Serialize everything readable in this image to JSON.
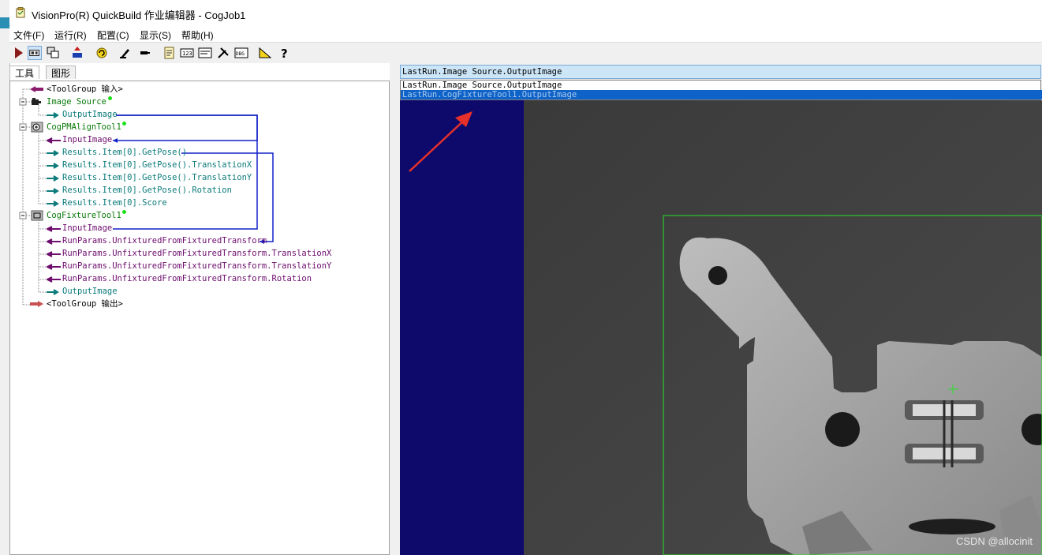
{
  "window": {
    "title": "VisionPro(R) QuickBuild 作业编辑器 - CogJob1"
  },
  "menu": [
    {
      "label": "文件(F)"
    },
    {
      "label": "运行(R)"
    },
    {
      "label": "配置(C)"
    },
    {
      "label": "显示(S)"
    },
    {
      "label": "帮助(H)"
    }
  ],
  "toolbar_icons": [
    "run-icon",
    "run-continuous-icon",
    "settings-icon",
    "reset-icon",
    "refresh-icon",
    "edit-icon",
    "tool-icon",
    "notes-icon",
    "counter-icon",
    "display-icon",
    "wrench-icon",
    "debug-icon",
    "ruler-icon",
    "help-icon"
  ],
  "tabs": {
    "tools": "工具",
    "graphics": "图形"
  },
  "tree": {
    "input": "<ToolGroup 输入>",
    "image_source": "Image Source",
    "image_source_output": "OutputImage",
    "pm_align": "CogPMAlignTool1",
    "pm_input": "InputImage",
    "pm_pose": "Results.Item[0].GetPose()",
    "pm_tx": "Results.Item[0].GetPose().TranslationX",
    "pm_ty": "Results.Item[0].GetPose().TranslationY",
    "pm_rot": "Results.Item[0].GetPose().Rotation",
    "pm_score": "Results.Item[0].Score",
    "fixture": "CogFixtureTool1",
    "fx_input": "InputImage",
    "fx_transform": "RunParams.UnfixturedFromFixturedTransform",
    "fx_tx": "RunParams.UnfixturedFromFixturedTransform.TranslationX",
    "fx_ty": "RunParams.UnfixturedFromFixturedTransform.TranslationY",
    "fx_rot": "RunParams.UnfixturedFromFixturedTransform.Rotation",
    "fx_output": "OutputImage",
    "output": "<ToolGroup 输出>"
  },
  "image_selector": {
    "selected": "LastRun.Image Source.OutputImage",
    "options": [
      "LastRun.Image Source.OutputImage",
      "LastRun.CogFixtureTool1.OutputImage"
    ],
    "highlighted_index": 1
  },
  "watermark": "CSDN @allocinit",
  "colors": {
    "accent_teal": "#0c7b7b",
    "accent_purple": "#6d0d6d",
    "display_bg": "#0d0a6b",
    "highlight": "#0f63c8",
    "roi": "#28e028"
  }
}
